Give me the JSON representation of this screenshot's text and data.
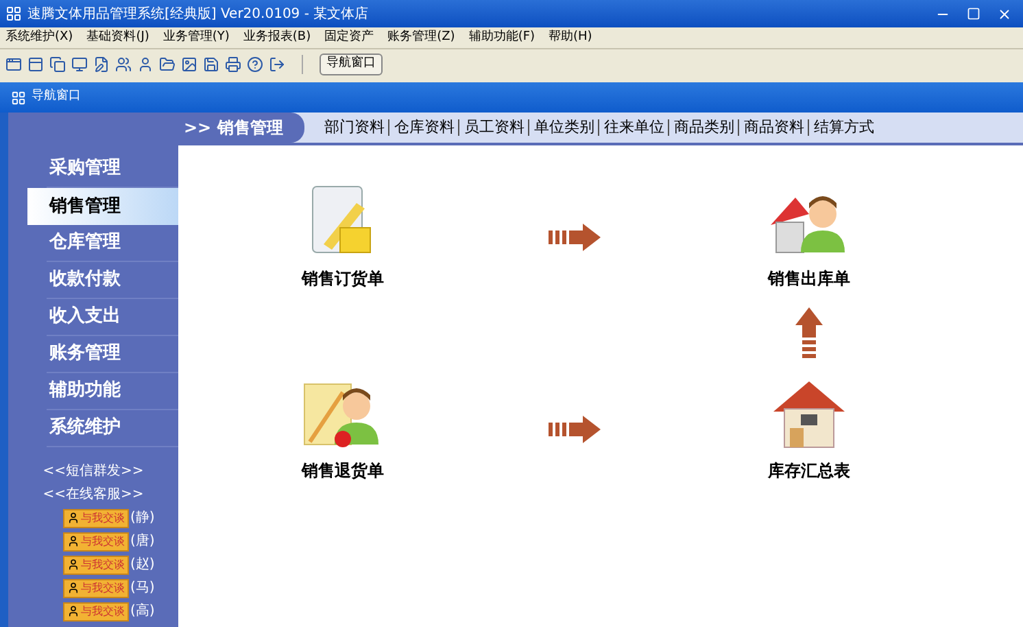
{
  "window": {
    "title": "速腾文体用品管理系统[经典版] Ver20.0109  -  某文体店"
  },
  "menu": [
    "系统维护(X)",
    "基础资料(J)",
    "业务管理(Y)",
    "业务报表(B)",
    "固定资产",
    "账务管理(Z)",
    "辅助功能(F)",
    "帮助(H)"
  ],
  "toolbar": {
    "nav_button": "导航窗口"
  },
  "nav_window": {
    "title": "导航窗口"
  },
  "sidebar": {
    "items": [
      {
        "label": "采购管理",
        "selected": false
      },
      {
        "label": "销售管理",
        "selected": true
      },
      {
        "label": "仓库管理",
        "selected": false
      },
      {
        "label": "收款付款",
        "selected": false
      },
      {
        "label": "收入支出",
        "selected": false
      },
      {
        "label": "账务管理",
        "selected": false
      },
      {
        "label": "辅助功能",
        "selected": false
      },
      {
        "label": "系统维护",
        "selected": false
      }
    ],
    "links": [
      "<<短信群发>>",
      "<<在线客服>>"
    ],
    "chat": [
      {
        "button": "与我交谈",
        "name": "(静)"
      },
      {
        "button": "与我交谈",
        "name": "(唐)"
      },
      {
        "button": "与我交谈",
        "name": "(赵)"
      },
      {
        "button": "与我交谈",
        "name": "(马)"
      },
      {
        "button": "与我交谈",
        "name": "(高)"
      }
    ]
  },
  "section": {
    "title": ">> 销售管理",
    "links": [
      "部门资料",
      "仓库资料",
      "员工资料",
      "单位类别",
      "往来单位",
      "商品类别",
      "商品资料",
      "结算方式"
    ]
  },
  "flow": [
    {
      "kind": "order",
      "label": "销售订货单"
    },
    {
      "kind": "outbound",
      "label": "销售出库单"
    },
    {
      "kind": "return",
      "label": "销售退货单"
    },
    {
      "kind": "stock",
      "label": "库存汇总表"
    }
  ]
}
